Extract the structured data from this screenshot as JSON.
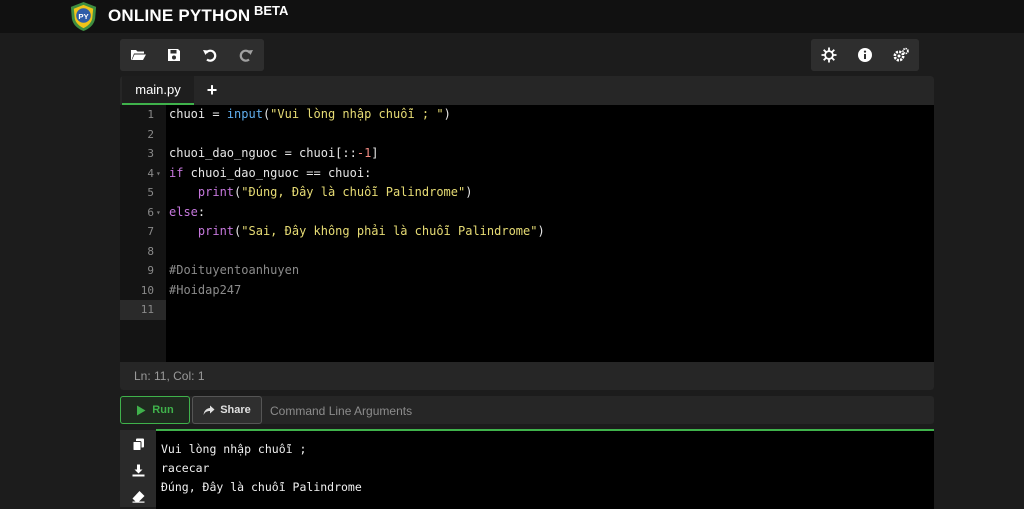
{
  "header": {
    "brand": "ONLINE PYTHON",
    "badge": "BETA",
    "logo_text": "PY"
  },
  "toolbar_left": [
    "open-folder-icon",
    "save-icon",
    "undo-icon",
    "redo-icon"
  ],
  "toolbar_right": [
    "theme-icon",
    "info-icon",
    "settings-icon"
  ],
  "tabs": [
    {
      "label": "main.py"
    }
  ],
  "tab_add_label": "+",
  "code_lines": [
    {
      "n": "1",
      "fold": "",
      "tokens": [
        [
          "",
          "chuoi "
        ],
        [
          "op",
          "= "
        ],
        [
          "fn",
          "input"
        ],
        [
          "",
          "("
        ],
        [
          "st",
          "\"Vui lòng nhập chuỗi ; \""
        ],
        [
          "",
          ")"
        ]
      ]
    },
    {
      "n": "2",
      "fold": "",
      "tokens": []
    },
    {
      "n": "3",
      "fold": "",
      "tokens": [
        [
          "",
          "chuoi_dao_nguoc "
        ],
        [
          "op",
          "= "
        ],
        [
          "",
          "chuoi[::"
        ],
        [
          "nm",
          "-1"
        ],
        [
          "",
          "]"
        ]
      ]
    },
    {
      "n": "4",
      "fold": "▾",
      "tokens": [
        [
          "kw",
          "if"
        ],
        [
          "",
          " chuoi_dao_nguoc "
        ],
        [
          "op",
          "=="
        ],
        [
          "",
          " chuoi:"
        ]
      ]
    },
    {
      "n": "5",
      "fold": "",
      "tokens": [
        [
          "",
          "    "
        ],
        [
          "kw",
          "print"
        ],
        [
          "",
          "("
        ],
        [
          "st",
          "\"Đúng, Đây là chuỗi Palindrome\""
        ],
        [
          "",
          ")"
        ]
      ]
    },
    {
      "n": "6",
      "fold": "▾",
      "tokens": [
        [
          "kw",
          "else"
        ],
        [
          "",
          ":"
        ]
      ]
    },
    {
      "n": "7",
      "fold": "",
      "tokens": [
        [
          "",
          "    "
        ],
        [
          "kw",
          "print"
        ],
        [
          "",
          "("
        ],
        [
          "st",
          "\"Sai, Đây không phải là chuỗi Palindrome\""
        ],
        [
          "",
          ")"
        ]
      ]
    },
    {
      "n": "8",
      "fold": "",
      "tokens": []
    },
    {
      "n": "9",
      "fold": "",
      "tokens": [
        [
          "cm",
          "#Doituyentoanhuyen"
        ]
      ]
    },
    {
      "n": "10",
      "fold": "",
      "tokens": [
        [
          "cm",
          "#Hoidap247"
        ]
      ]
    },
    {
      "n": "11",
      "fold": "",
      "tokens": []
    }
  ],
  "active_line": "11",
  "status": {
    "text": "Ln: 11,  Col: 1"
  },
  "run": {
    "run_label": "Run",
    "share_label": "Share",
    "args_placeholder": "Command Line Arguments"
  },
  "output_tools": [
    "copy-icon",
    "download-icon",
    "eraser-icon"
  ],
  "output_lines": [
    "Vui lòng nhập chuỗi ;",
    "racecar",
    "Đúng, Đây là chuỗi Palindrome"
  ],
  "colors": {
    "accent": "#3fb24b",
    "keyword": "#c678dd",
    "function": "#61afef",
    "string": "#e6db74",
    "number": "#f28b82",
    "comment": "#8b8b8b"
  }
}
